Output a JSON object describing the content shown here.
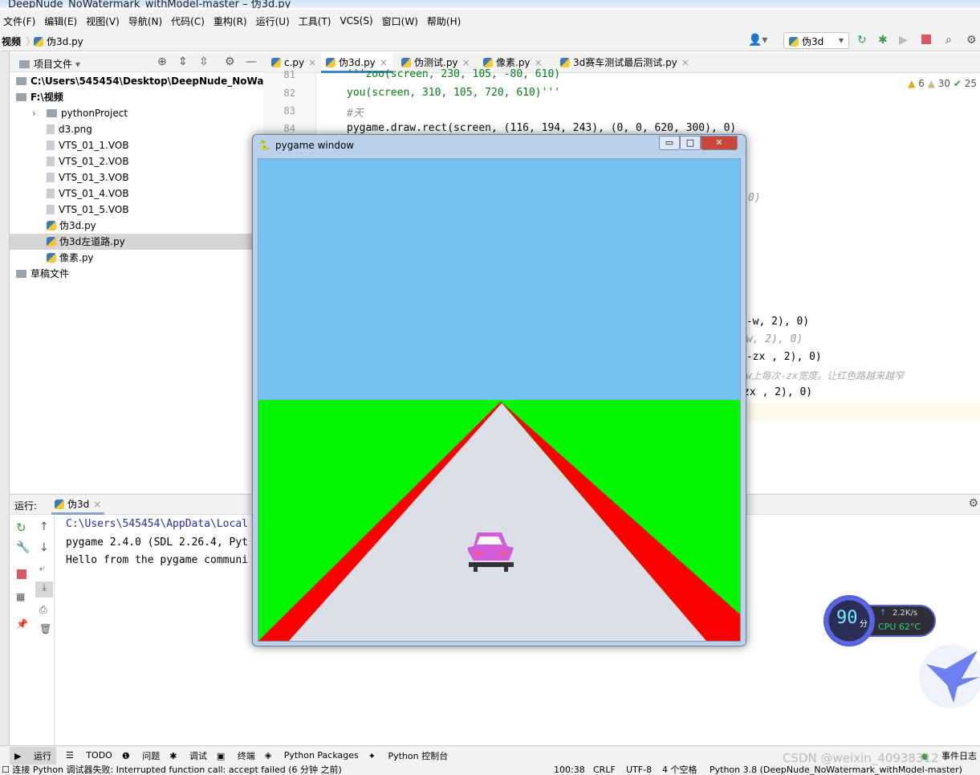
{
  "window_title": "DeepNude_NoWatermark_withModel-master – 伪3d.py",
  "menu": [
    "文件(F)",
    "编辑(E)",
    "视图(V)",
    "导航(N)",
    "代码(C)",
    "重构(R)",
    "运行(U)",
    "工具(T)",
    "VCS(S)",
    "窗口(W)",
    "帮助(H)"
  ],
  "breadcrumb": [
    "视频",
    "伪3d.py"
  ],
  "toolbar": {
    "run_config": "伪3d"
  },
  "project": {
    "header": "项目文件",
    "items": [
      {
        "label": "C:\\Users\\545454\\Desktop\\DeepNude_NoWat",
        "type": "folder",
        "level": 0,
        "bold": true
      },
      {
        "label": "F:\\视频",
        "type": "folder",
        "level": 0,
        "bold": true
      },
      {
        "label": "pythonProject",
        "type": "folder",
        "level": 1
      },
      {
        "label": "d3.png",
        "type": "file",
        "level": 1
      },
      {
        "label": "VTS_01_1.VOB",
        "type": "file",
        "level": 1
      },
      {
        "label": "VTS_01_2.VOB",
        "type": "file",
        "level": 1
      },
      {
        "label": "VTS_01_3.VOB",
        "type": "file",
        "level": 1
      },
      {
        "label": "VTS_01_4.VOB",
        "type": "file",
        "level": 1
      },
      {
        "label": "VTS_01_5.VOB",
        "type": "file",
        "level": 1
      },
      {
        "label": "伪3d.py",
        "type": "py",
        "level": 1
      },
      {
        "label": "伪3d左道路.py",
        "type": "py",
        "level": 1,
        "selected": true
      },
      {
        "label": "像素.py",
        "type": "py",
        "level": 1
      },
      {
        "label": "草稿文件",
        "type": "folder",
        "level": 0
      }
    ]
  },
  "tabs": [
    "c.py",
    "伪3d.py",
    "伪测试.py",
    "像素.py",
    "3d赛车测试最后测试.py"
  ],
  "active_tab": 1,
  "inspections": {
    "warnings": "6",
    "weak_warnings": "30",
    "typos": "25"
  },
  "editor": {
    "lines": [
      {
        "n": "81",
        "text": "'''zoo(screen, 230, 105, -80, 610)"
      },
      {
        "n": "82",
        "text": "you(screen, 310, 105, 720, 610)'''"
      },
      {
        "n": "83",
        "text": "#天"
      },
      {
        "n": "84",
        "text": "pygame.draw.rect(screen, (116, 194, 243), (0, 0, 620, 300), 0)"
      }
    ],
    "fragments": [
      "0)",
      "w-w, 2), 0)",
      "lw, 2), 0)",
      "w-zx , 2), 0)",
      "zw上每次-zx宽度。让红色路越来越窄",
      "zx , 2), 0)"
    ]
  },
  "pygame": {
    "title": "pygame window",
    "sky": "#74c2f3",
    "grass": "#00f500",
    "road": "#dcdfe8",
    "edge": "#ff0000"
  },
  "run": {
    "label": "运行:",
    "tab": "伪3d",
    "console": [
      "C:\\Users\\545454\\AppData\\Local",
      "pygame 2.4.0 (SDL 2.26.4, Pyt",
      "Hello from the pygame communi"
    ]
  },
  "bottom_tools": [
    "运行",
    "TODO",
    "问题",
    "调试",
    "终端",
    "Python Packages",
    "Python 控制台",
    "事件日志"
  ],
  "status": {
    "message": "连接 Python 调试器失败: Interrupted function call: accept failed (6 分钟 之前)",
    "position": "100:38",
    "line_sep": "CRLF",
    "encoding": "UTF-8",
    "indent": "4 个空格",
    "interpreter": "Python 3.8 (DeepNude_NoWatermark_withModel-master)"
  },
  "widget": {
    "score": "90",
    "score_unit": "分",
    "net": "2.2K/s",
    "cpu": "CPU 62°C"
  },
  "watermark": "CSDN @weixin_40938312"
}
